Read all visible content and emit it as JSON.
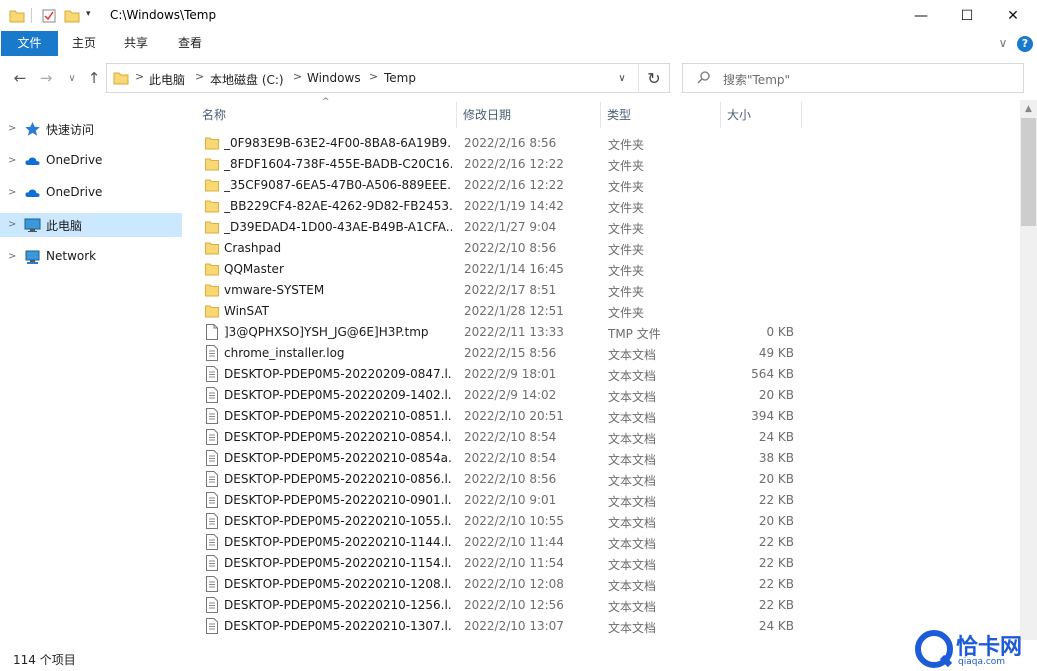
{
  "window": {
    "title": "C:\\Windows\\Temp",
    "minimize_glyph": "—",
    "maximize_glyph": "☐",
    "close_glyph": "✕"
  },
  "ribbon": {
    "tabs": [
      "文件",
      "主页",
      "共享",
      "查看"
    ],
    "expand_glyph": "∨",
    "help_glyph": "?"
  },
  "navigation": {
    "back_glyph": "←",
    "forward_glyph": "→",
    "recent_glyph": "∨",
    "up_glyph": "↑"
  },
  "address": {
    "crumbs": [
      "此电脑",
      "本地磁盘 (C:)",
      "Windows",
      "Temp"
    ],
    "separator": ">",
    "dropdown_glyph": "∨",
    "refresh_glyph": "↻"
  },
  "search": {
    "placeholder": "搜索\"Temp\""
  },
  "sidebar": {
    "items": [
      {
        "label": "快速访问",
        "icon": "star-icon"
      },
      {
        "label": "OneDrive",
        "icon": "cloud-icon"
      },
      {
        "label": "OneDrive",
        "icon": "cloud-icon"
      },
      {
        "label": "此电脑",
        "icon": "computer-icon",
        "selected": true
      },
      {
        "label": "Network",
        "icon": "network-icon"
      }
    ]
  },
  "columns": {
    "name": "名称",
    "date": "修改日期",
    "type": "类型",
    "size": "大小",
    "sort_glyph": "^"
  },
  "files": [
    {
      "name": "_0F983E9B-63E2-4F00-8BA8-6A19B9...",
      "date": "2022/2/16 8:56",
      "type": "文件夹",
      "size": "",
      "kind": "folder"
    },
    {
      "name": "_8FDF1604-738F-455E-BADB-C20C16...",
      "date": "2022/2/16 12:22",
      "type": "文件夹",
      "size": "",
      "kind": "folder"
    },
    {
      "name": "_35CF9087-6EA5-47B0-A506-889EEE...",
      "date": "2022/2/16 12:22",
      "type": "文件夹",
      "size": "",
      "kind": "folder"
    },
    {
      "name": "_BB229CF4-82AE-4262-9D82-FB2453...",
      "date": "2022/1/19 14:42",
      "type": "文件夹",
      "size": "",
      "kind": "folder"
    },
    {
      "name": "_D39EDAD4-1D00-43AE-B49B-A1CFA...",
      "date": "2022/1/27 9:04",
      "type": "文件夹",
      "size": "",
      "kind": "folder"
    },
    {
      "name": "Crashpad",
      "date": "2022/2/10 8:56",
      "type": "文件夹",
      "size": "",
      "kind": "folder"
    },
    {
      "name": "QQMaster",
      "date": "2022/1/14 16:45",
      "type": "文件夹",
      "size": "",
      "kind": "folder"
    },
    {
      "name": "vmware-SYSTEM",
      "date": "2022/2/17 8:51",
      "type": "文件夹",
      "size": "",
      "kind": "folder"
    },
    {
      "name": "WinSAT",
      "date": "2022/1/28 12:51",
      "type": "文件夹",
      "size": "",
      "kind": "folder"
    },
    {
      "name": "]3@QPHXSO]YSH_JG@6E]H3P.tmp",
      "date": "2022/2/11 13:33",
      "type": "TMP 文件",
      "size": "0 KB",
      "kind": "file"
    },
    {
      "name": "chrome_installer.log",
      "date": "2022/2/15 8:56",
      "type": "文本文档",
      "size": "49 KB",
      "kind": "text"
    },
    {
      "name": "DESKTOP-PDEP0M5-20220209-0847.l...",
      "date": "2022/2/9 18:01",
      "type": "文本文档",
      "size": "564 KB",
      "kind": "text"
    },
    {
      "name": "DESKTOP-PDEP0M5-20220209-1402.l...",
      "date": "2022/2/9 14:02",
      "type": "文本文档",
      "size": "20 KB",
      "kind": "text"
    },
    {
      "name": "DESKTOP-PDEP0M5-20220210-0851.l...",
      "date": "2022/2/10 20:51",
      "type": "文本文档",
      "size": "394 KB",
      "kind": "text"
    },
    {
      "name": "DESKTOP-PDEP0M5-20220210-0854.l...",
      "date": "2022/2/10 8:54",
      "type": "文本文档",
      "size": "24 KB",
      "kind": "text"
    },
    {
      "name": "DESKTOP-PDEP0M5-20220210-0854a...",
      "date": "2022/2/10 8:54",
      "type": "文本文档",
      "size": "38 KB",
      "kind": "text"
    },
    {
      "name": "DESKTOP-PDEP0M5-20220210-0856.l...",
      "date": "2022/2/10 8:56",
      "type": "文本文档",
      "size": "20 KB",
      "kind": "text"
    },
    {
      "name": "DESKTOP-PDEP0M5-20220210-0901.l...",
      "date": "2022/2/10 9:01",
      "type": "文本文档",
      "size": "22 KB",
      "kind": "text"
    },
    {
      "name": "DESKTOP-PDEP0M5-20220210-1055.l...",
      "date": "2022/2/10 10:55",
      "type": "文本文档",
      "size": "20 KB",
      "kind": "text"
    },
    {
      "name": "DESKTOP-PDEP0M5-20220210-1144.l...",
      "date": "2022/2/10 11:44",
      "type": "文本文档",
      "size": "22 KB",
      "kind": "text"
    },
    {
      "name": "DESKTOP-PDEP0M5-20220210-1154.l...",
      "date": "2022/2/10 11:54",
      "type": "文本文档",
      "size": "22 KB",
      "kind": "text"
    },
    {
      "name": "DESKTOP-PDEP0M5-20220210-1208.l...",
      "date": "2022/2/10 12:08",
      "type": "文本文档",
      "size": "22 KB",
      "kind": "text"
    },
    {
      "name": "DESKTOP-PDEP0M5-20220210-1256.l...",
      "date": "2022/2/10 12:56",
      "type": "文本文档",
      "size": "22 KB",
      "kind": "text"
    },
    {
      "name": "DESKTOP-PDEP0M5-20220210-1307.l...",
      "date": "2022/2/10 13:07",
      "type": "文本文档",
      "size": "24 KB",
      "kind": "text"
    }
  ],
  "status": {
    "item_count": "114 个项目"
  },
  "watermark": {
    "name": "恰卡网",
    "url": "qiaqa.com"
  },
  "colors": {
    "accent": "#1979ca",
    "selected_bg": "#cce8ff",
    "folder": "#f8d775",
    "header_text": "#4c607a"
  }
}
